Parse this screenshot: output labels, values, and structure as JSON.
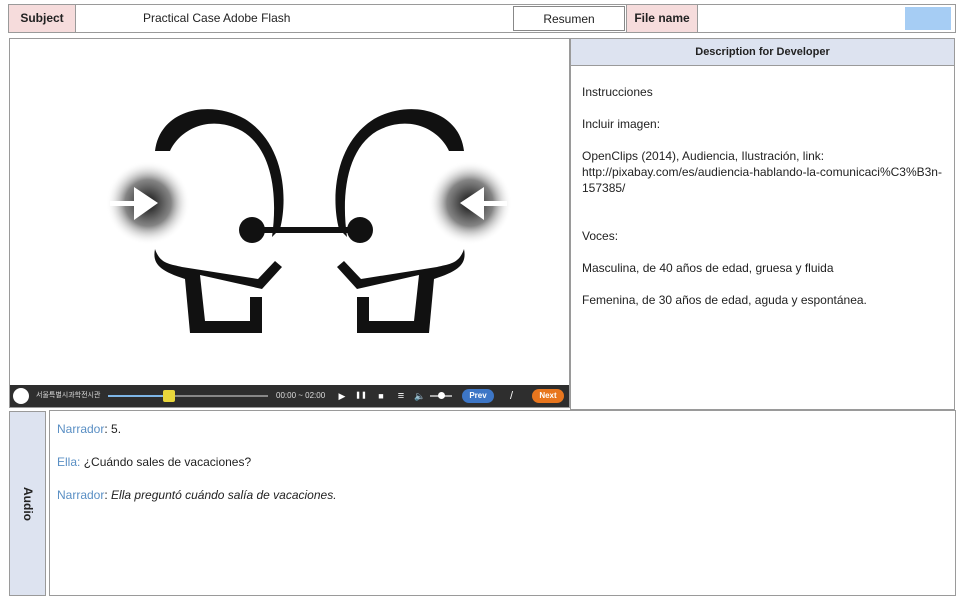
{
  "header": {
    "subject_label": "Subject",
    "subject_value": "Practical Case Adobe Flash",
    "resumen_button": "Resumen",
    "file_name_label": "File name",
    "file_name_value": ""
  },
  "player": {
    "organization": "서울특별시과학전시관",
    "time": "00:00 ~ 02:00",
    "play_icon": "▶",
    "pause_icon": "❚❚",
    "stop_icon": "■",
    "menu_icon": "≡",
    "prev_label": "Prev",
    "page_separator": "/",
    "next_label": "Next",
    "progress_fraction": 0.38,
    "volume_fraction": 0.5
  },
  "description": {
    "header": "Description for Developer",
    "instructions": "Instrucciones",
    "include_image": "Incluir imagen:",
    "credit": "OpenClips (2014), Audiencia, Ilustración, link:",
    "link": "http://pixabay.com/es/audiencia-hablando-la-comunicaci%C3%B3n-157385/",
    "voices_title": "Voces:",
    "voice_male": "Masculina, de 40 años de edad, gruesa y fluida",
    "voice_female": "Femenina, de 30 años de edad, aguda y espontánea."
  },
  "audio": {
    "label": "Audio",
    "lines": [
      {
        "speaker": "Narrador",
        "separator": ":",
        "text": "5."
      },
      {
        "speaker": "Ella",
        "separator": ":",
        "text": "¿Cuándo sales de vacaciones?"
      },
      {
        "speaker": "Narrador",
        "separator": ":",
        "text": "Ella preguntó cuándo salía de vacaciones."
      }
    ]
  },
  "colors": {
    "label_pink": "#f6dcdc",
    "label_blue": "#dde3f0",
    "speaker_blue": "#5a8fc4",
    "prev_blue": "#3d76c6",
    "next_orange": "#e8761e"
  }
}
